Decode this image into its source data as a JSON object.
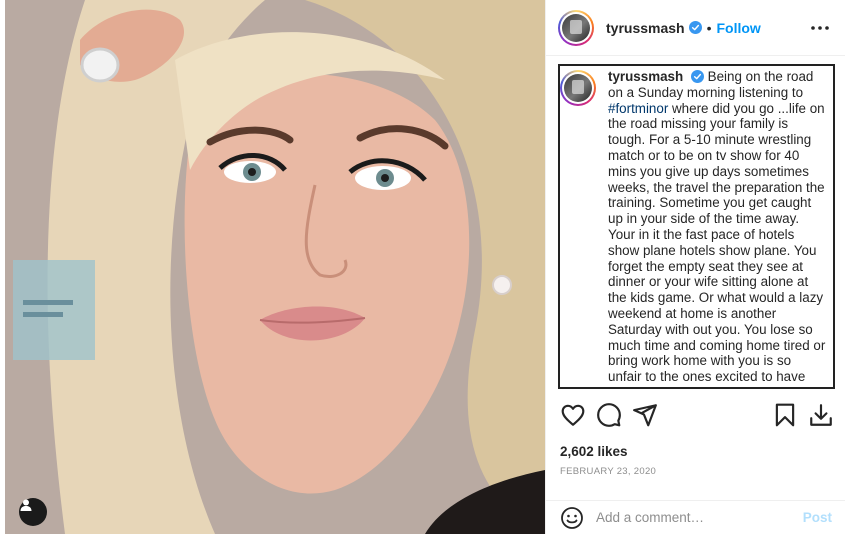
{
  "post": {
    "username": "tyrussmash",
    "verified": true,
    "separator": "•",
    "follow_label": "Follow",
    "caption": {
      "username": "tyrussmash",
      "text_before_hashtag": "Being on the road on a Sunday morning listening to ",
      "hashtag": "#fortminor",
      "text_after_hashtag": " where did you go ...life on the road missing your family is tough. For a 5-10 minute wrestling match or to be on tv show for 40 mins you give up days sometimes weeks, the travel the preparation the training. Sometime you get caught up in your side of the time away. Your in it the fast pace of hotels show plane hotels show plane. You forget the empty seat they see at dinner or your wife sitting alone at the kids game. Or what would a lazy weekend at home is another Saturday with out you. You lose so much time and coming home tired or bring work home with you is so unfair to the ones excited to have you home. Maybe don't grab a beer"
    },
    "likes": "2,602 likes",
    "date": "FEBRUARY 23, 2020",
    "comment_placeholder": "Add a comment…",
    "post_label": "Post"
  },
  "icons": {
    "more": "more-options-icon",
    "like": "heart-icon",
    "comment": "comment-icon",
    "share": "share-icon",
    "save": "bookmark-icon",
    "download": "download-icon",
    "emoji": "emoji-icon",
    "verified": "verified-badge-icon",
    "user_tag": "user-tag-icon"
  },
  "colors": {
    "link_blue": "#0095f6",
    "hashtag": "#00376b",
    "verified": "#3897f0",
    "muted": "#8e8e8e",
    "post_disabled": "#b2dffc"
  }
}
